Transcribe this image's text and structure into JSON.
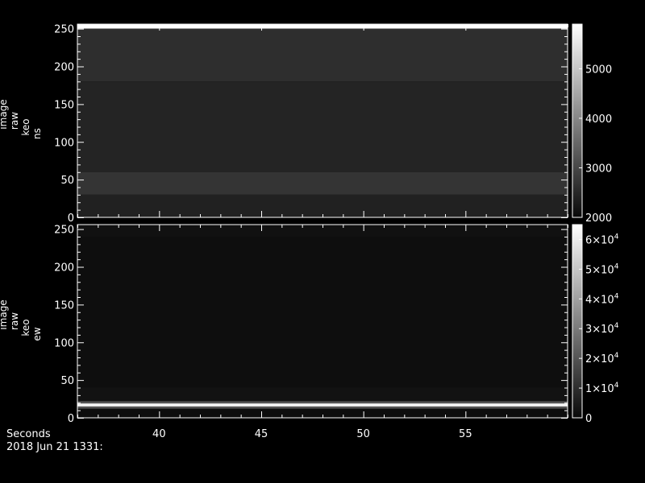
{
  "footer": {
    "xaxis_title": "Seconds",
    "date": "2018 Jun 21 1331:"
  },
  "colors": {
    "background": "#000000",
    "axes": "#ffffff"
  },
  "chart_data": [
    {
      "type": "heatmap",
      "colormap": "grayscale",
      "ylabel": [
        "image",
        "raw",
        "keo",
        "ns"
      ],
      "xlim": [
        36,
        60
      ],
      "x_ticks": [
        40,
        45,
        50,
        55
      ],
      "ylim": [
        0,
        256
      ],
      "y_ticks": [
        0,
        50,
        100,
        150,
        200,
        250
      ],
      "colorbar": {
        "range": [
          2000,
          5900
        ],
        "ticks": [
          {
            "value": 2000,
            "label": "2000"
          },
          {
            "value": 3000,
            "label": "3000"
          },
          {
            "value": 4000,
            "label": "4000"
          },
          {
            "value": 5000,
            "label": "5000"
          }
        ]
      },
      "bands": [
        {
          "y0": 250,
          "y1": 256,
          "value": 5900
        },
        {
          "y0": 180,
          "y1": 250,
          "value": 2600
        },
        {
          "y0": 60,
          "y1": 180,
          "value": 2450
        },
        {
          "y0": 30,
          "y1": 60,
          "value": 2700
        },
        {
          "y0": 0,
          "y1": 30,
          "value": 2400
        }
      ]
    },
    {
      "type": "heatmap",
      "colormap": "grayscale",
      "ylabel": [
        "image",
        "raw",
        "keo",
        "ew"
      ],
      "xlim": [
        36,
        60
      ],
      "x_ticks": [
        40,
        45,
        50,
        55
      ],
      "ylim": [
        0,
        256
      ],
      "y_ticks": [
        0,
        50,
        100,
        150,
        200,
        250
      ],
      "colorbar": {
        "range": [
          0,
          65000
        ],
        "ticks": [
          {
            "value": 0,
            "label": "0"
          },
          {
            "value": 10000,
            "label": "1×10",
            "exp": "4"
          },
          {
            "value": 20000,
            "label": "2×10",
            "exp": "4"
          },
          {
            "value": 30000,
            "label": "3×10",
            "exp": "4"
          },
          {
            "value": 40000,
            "label": "4×10",
            "exp": "4"
          },
          {
            "value": 50000,
            "label": "5×10",
            "exp": "4"
          },
          {
            "value": 60000,
            "label": "6×10",
            "exp": "4"
          }
        ]
      },
      "bands": [
        {
          "y0": 240,
          "y1": 256,
          "value": 2500
        },
        {
          "y0": 40,
          "y1": 240,
          "value": 1800
        },
        {
          "y0": 22,
          "y1": 40,
          "value": 2800
        },
        {
          "y0": 19,
          "y1": 22,
          "value": 20000
        },
        {
          "y0": 15,
          "y1": 19,
          "value": 63000
        },
        {
          "y0": 12,
          "y1": 15,
          "value": 20000
        },
        {
          "y0": 0,
          "y1": 12,
          "value": 1500
        }
      ]
    }
  ]
}
